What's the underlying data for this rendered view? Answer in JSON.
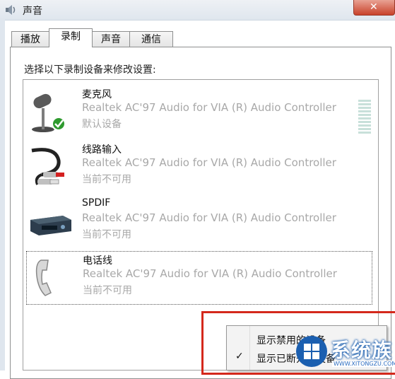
{
  "window": {
    "title": "声音",
    "close_glyph": "✕"
  },
  "tabs": [
    {
      "label": "播放"
    },
    {
      "label": "录制"
    },
    {
      "label": "声音"
    },
    {
      "label": "通信"
    }
  ],
  "instruction": "选择以下录制设备来修改设置:",
  "devices": [
    {
      "name": "麦克风",
      "description": "Realtek AC'97 Audio for VIA (R) Audio Controller",
      "status": "默认设备",
      "icon": "microphone-icon",
      "default_badge": "green-check-icon"
    },
    {
      "name": "线路输入",
      "description": "Realtek AC'97 Audio for VIA (R) Audio Controller",
      "status": "当前不可用",
      "icon": "line-in-cable-icon"
    },
    {
      "name": "SPDIF",
      "description": "Realtek AC'97 Audio for VIA (R) Audio Controller",
      "status": "当前不可用",
      "icon": "spdif-device-icon"
    },
    {
      "name": "电话线",
      "description": "Realtek AC'97 Audio for VIA (R) Audio Controller",
      "status": "当前不可用",
      "icon": "telephone-handset-icon"
    }
  ],
  "context_menu": {
    "items": [
      {
        "label": "显示禁用的设备",
        "checked": false
      },
      {
        "label": "显示已断开的设备",
        "checked": true
      }
    ],
    "check_glyph": "✓"
  },
  "watermark": {
    "text": "系统族",
    "url": "WWW.XITONGZU.COM"
  },
  "colors": {
    "highlight_frame": "#d4281c",
    "disabled_text": "#a8a8a8"
  }
}
